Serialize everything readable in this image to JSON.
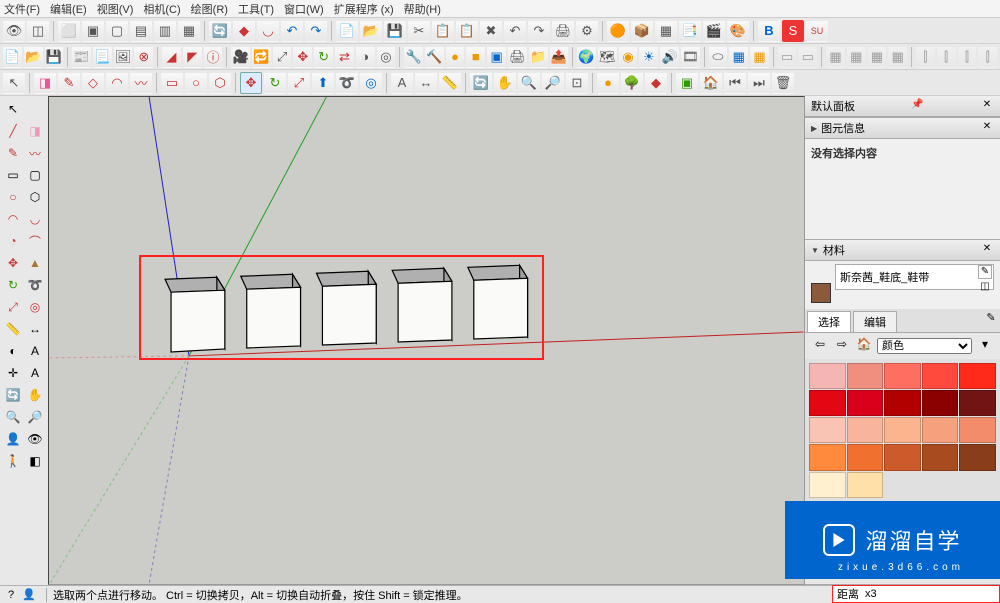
{
  "menu": {
    "file": "文件(F)",
    "edit": "编辑(E)",
    "view": "视图(V)",
    "camera": "相机(C)",
    "draw": "绘图(R)",
    "tools": "工具(T)",
    "window": "窗口(W)",
    "ext": "扩展程序 (x)",
    "help": "帮助(H)"
  },
  "panels": {
    "default_tray": "默认面板",
    "entity_info_title": "图元信息",
    "entity_info_empty": "没有选择内容",
    "materials_title": "材料",
    "material_name": "斯奈茜_鞋底_鞋带",
    "select_tab": "选择",
    "edit_tab": "编辑",
    "color_dropdown": "颜色"
  },
  "colors": [
    "#f5b5b5",
    "#f08f80",
    "#ff6f61",
    "#ff4a3d",
    "#ff2a1a",
    "#e30613",
    "#d9001b",
    "#b20000",
    "#8b0000",
    "#701414",
    "#f9c4b3",
    "#f8b49c",
    "#fcb48e",
    "#f6a17e",
    "#f28c6a",
    "#ff8a3d",
    "#f07030",
    "#cc5a2a",
    "#a84b1f",
    "#8a3d1a",
    "#fff0d0",
    "#ffe0a8"
  ],
  "status": {
    "hint": "选取两个点进行移动。 Ctrl = 切换拷贝，Alt = 切换自动折叠，按住 Shift = 锁定推理。",
    "measure_label": "距离",
    "measure_value": "x3"
  },
  "watermark": {
    "brand": "溜溜自学",
    "url": "zixue.3d66.com"
  }
}
